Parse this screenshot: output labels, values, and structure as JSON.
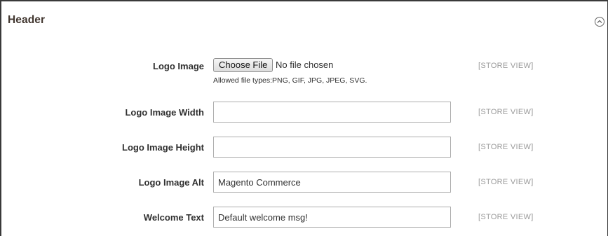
{
  "section": {
    "title": "Header",
    "collapse_icon": "chevron-up-circle-icon"
  },
  "fields": {
    "logo_image": {
      "label": "Logo Image",
      "button_label": "Choose File",
      "status": "No file chosen",
      "note": "Allowed file types:PNG, GIF, JPG, JPEG, SVG.",
      "scope": "[STORE VIEW]"
    },
    "logo_width": {
      "label": "Logo Image Width",
      "value": "",
      "scope": "[STORE VIEW]"
    },
    "logo_height": {
      "label": "Logo Image Height",
      "value": "",
      "scope": "[STORE VIEW]"
    },
    "logo_alt": {
      "label": "Logo Image Alt",
      "value": "Magento Commerce",
      "scope": "[STORE VIEW]"
    },
    "welcome_text": {
      "label": "Welcome Text",
      "value": "Default welcome msg!",
      "scope": "[STORE VIEW]"
    }
  }
}
